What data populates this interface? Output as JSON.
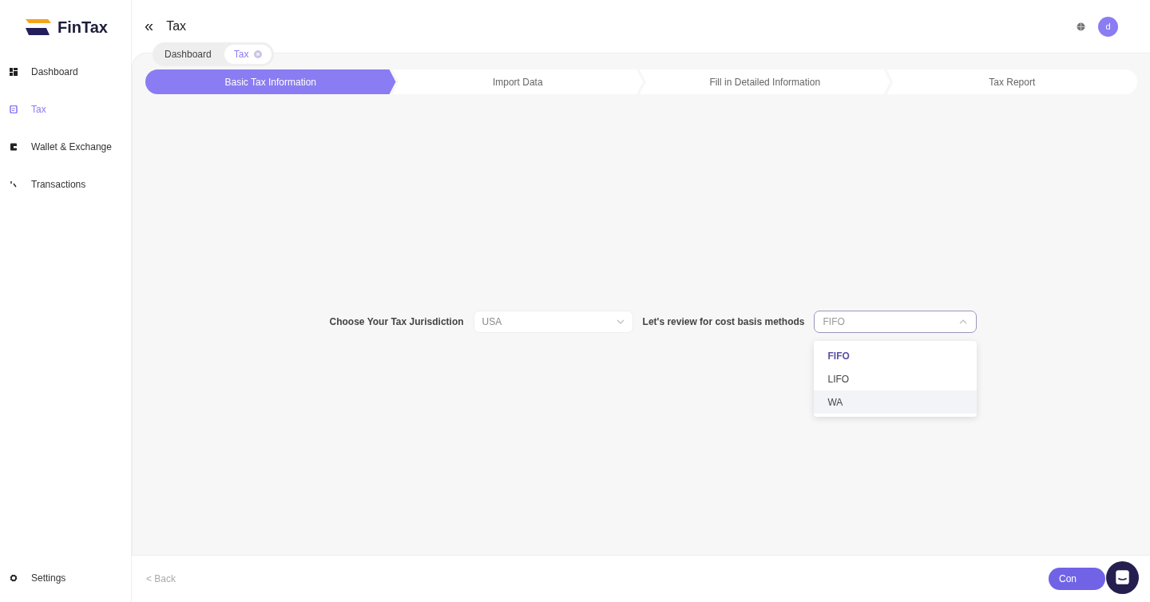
{
  "logo": {
    "text": "FinTax"
  },
  "header": {
    "collapse_icon": "«",
    "title": "Tax",
    "avatar": "d"
  },
  "sidebar": {
    "items": [
      {
        "label": "Dashboard",
        "kind": "grid",
        "selected": false
      },
      {
        "label": "Tax",
        "kind": "doc",
        "selected": true
      },
      {
        "label": "Wallet & Exchange",
        "kind": "wallet",
        "selected": false
      },
      {
        "label": "Transactions",
        "kind": "swap",
        "selected": false
      }
    ],
    "settings": "Settings"
  },
  "page_tabs": [
    {
      "label": "Dashboard",
      "selected": false,
      "closable": false
    },
    {
      "label": "Tax",
      "selected": true,
      "closable": true
    }
  ],
  "steps": [
    {
      "label": "Basic Tax Information",
      "selected": true
    },
    {
      "label": "Import Data",
      "selected": false
    },
    {
      "label": "Fill in Detailed Information",
      "selected": false
    },
    {
      "label": "Tax Report",
      "selected": false
    }
  ],
  "form": {
    "jurisdiction_label": "Choose Your Tax Jurisdiction",
    "jurisdiction_value": "USA",
    "method_label": "Let's review for cost basis methods",
    "method_placeholder": "FIFO",
    "expanded": true,
    "options": [
      {
        "label": "FIFO",
        "selected": true,
        "hovered": false
      },
      {
        "label": "LIFO",
        "selected": false,
        "hovered": false
      },
      {
        "label": "WA",
        "selected": false,
        "hovered": true
      }
    ]
  },
  "footer": {
    "back": "< Back",
    "continue": "Con"
  }
}
